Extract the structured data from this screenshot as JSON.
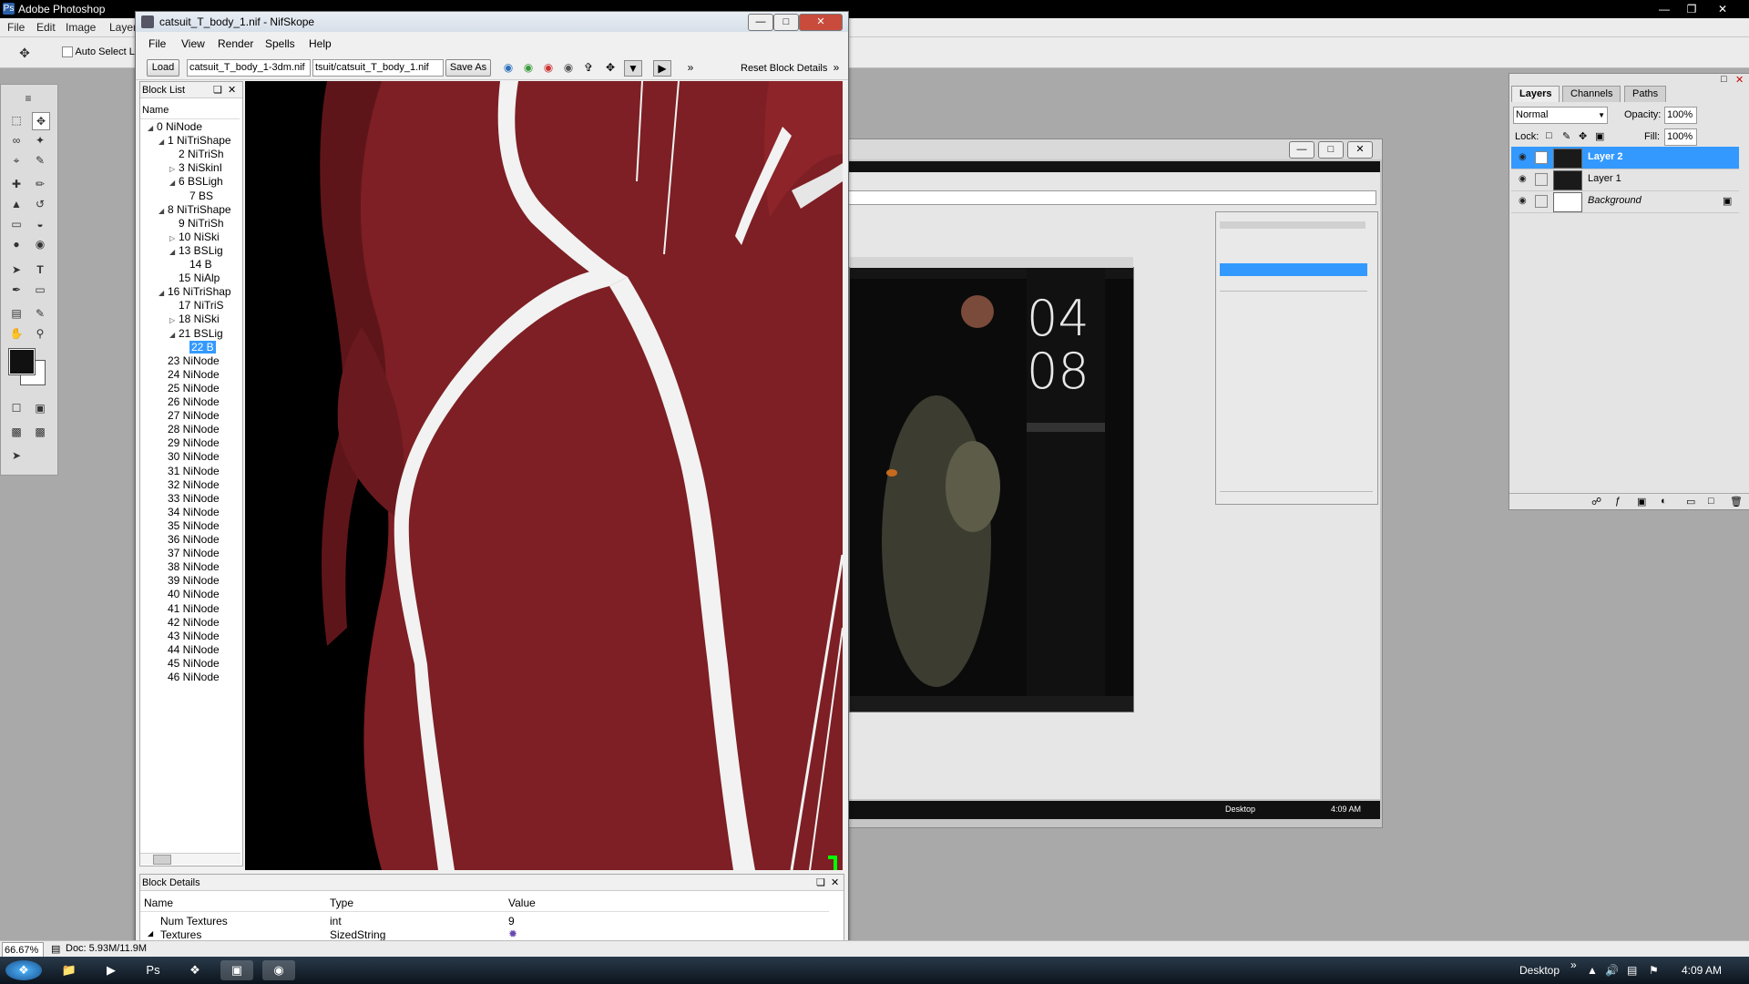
{
  "photoshop": {
    "title": "Adobe Photoshop",
    "menu": [
      "File",
      "Edit",
      "Image",
      "Layer"
    ],
    "auto_select_label": "Auto Select Layer",
    "zoom": "66.67%",
    "doc_info": "Doc: 5.93M/11.9M"
  },
  "nifskope": {
    "title": "catsuit_T_body_1.nif - NifSkope",
    "menu": [
      "File",
      "View",
      "Render",
      "Spells",
      "Help"
    ],
    "load_label": "Load",
    "load_path": "catsuit_T_body_1-3dm.nif",
    "save_path": "tsuit/catsuit_T_body_1.nif",
    "save_as_label": "Save As",
    "reset_label": "Reset Block Details",
    "block_list_title": "Block List",
    "name_header": "Name",
    "blocks": [
      {
        "indent": 0,
        "twisty": "open",
        "label": "0 NiNode"
      },
      {
        "indent": 1,
        "twisty": "open",
        "label": "1 NiTriShape"
      },
      {
        "indent": 2,
        "twisty": "",
        "label": "2 NiTriSh"
      },
      {
        "indent": 2,
        "twisty": "closed",
        "label": "3 NiSkinI"
      },
      {
        "indent": 2,
        "twisty": "open",
        "label": "6 BSLigh"
      },
      {
        "indent": 3,
        "twisty": "",
        "label": "7 BS"
      },
      {
        "indent": 1,
        "twisty": "open",
        "label": "8 NiTriShape"
      },
      {
        "indent": 2,
        "twisty": "",
        "label": "9 NiTriSh"
      },
      {
        "indent": 2,
        "twisty": "closed",
        "label": "10 NiSki"
      },
      {
        "indent": 2,
        "twisty": "open",
        "label": "13 BSLig"
      },
      {
        "indent": 3,
        "twisty": "",
        "label": "14 B"
      },
      {
        "indent": 2,
        "twisty": "",
        "label": "15 NiAlp"
      },
      {
        "indent": 1,
        "twisty": "open",
        "label": "16 NiTriShap"
      },
      {
        "indent": 2,
        "twisty": "",
        "label": "17 NiTriS"
      },
      {
        "indent": 2,
        "twisty": "closed",
        "label": "18 NiSki"
      },
      {
        "indent": 2,
        "twisty": "open",
        "label": "21 BSLig"
      },
      {
        "indent": 3,
        "twisty": "",
        "label": "22 B",
        "selected": true
      },
      {
        "indent": 1,
        "twisty": "",
        "label": "23 NiNode"
      },
      {
        "indent": 1,
        "twisty": "",
        "label": "24 NiNode"
      },
      {
        "indent": 1,
        "twisty": "",
        "label": "25 NiNode"
      },
      {
        "indent": 1,
        "twisty": "",
        "label": "26 NiNode"
      },
      {
        "indent": 1,
        "twisty": "",
        "label": "27 NiNode"
      },
      {
        "indent": 1,
        "twisty": "",
        "label": "28 NiNode"
      },
      {
        "indent": 1,
        "twisty": "",
        "label": "29 NiNode"
      },
      {
        "indent": 1,
        "twisty": "",
        "label": "30 NiNode"
      },
      {
        "indent": 1,
        "twisty": "",
        "label": "31 NiNode"
      },
      {
        "indent": 1,
        "twisty": "",
        "label": "32 NiNode"
      },
      {
        "indent": 1,
        "twisty": "",
        "label": "33 NiNode"
      },
      {
        "indent": 1,
        "twisty": "",
        "label": "34 NiNode"
      },
      {
        "indent": 1,
        "twisty": "",
        "label": "35 NiNode"
      },
      {
        "indent": 1,
        "twisty": "",
        "label": "36 NiNode"
      },
      {
        "indent": 1,
        "twisty": "",
        "label": "37 NiNode"
      },
      {
        "indent": 1,
        "twisty": "",
        "label": "38 NiNode"
      },
      {
        "indent": 1,
        "twisty": "",
        "label": "39 NiNode"
      },
      {
        "indent": 1,
        "twisty": "",
        "label": "40 NiNode"
      },
      {
        "indent": 1,
        "twisty": "",
        "label": "41 NiNode"
      },
      {
        "indent": 1,
        "twisty": "",
        "label": "42 NiNode"
      },
      {
        "indent": 1,
        "twisty": "",
        "label": "43 NiNode"
      },
      {
        "indent": 1,
        "twisty": "",
        "label": "44 NiNode"
      },
      {
        "indent": 1,
        "twisty": "",
        "label": "45 NiNode"
      },
      {
        "indent": 1,
        "twisty": "",
        "label": "46 NiNode"
      }
    ],
    "details_title": "Block Details",
    "details_headers": [
      "Name",
      "Type",
      "Value"
    ],
    "details_rows": [
      {
        "name": "Num Textures",
        "type": "int",
        "value": "9"
      },
      {
        "name": "Textures",
        "type": "SizedString",
        "value": ""
      }
    ]
  },
  "desktop_preview": {
    "clock_top": "04",
    "clock_bottom": "08",
    "taskbar_desktop": "Desktop",
    "taskbar_time": "4:09 AM"
  },
  "layers_panel": {
    "tabs": [
      "Layers",
      "Channels",
      "Paths"
    ],
    "blend_mode": "Normal",
    "opacity_label": "Opacity:",
    "opacity_value": "100%",
    "lock_label": "Lock:",
    "fill_label": "Fill:",
    "fill_value": "100%",
    "layers": [
      {
        "name": "Layer 2",
        "active": true
      },
      {
        "name": "Layer 1",
        "active": false
      },
      {
        "name": "Background",
        "active": false
      }
    ]
  },
  "taskbar": {
    "desktop_label": "Desktop",
    "time": "4:09 AM"
  },
  "colors": {
    "selection": "#3399ff",
    "body_red": "#7d1f24",
    "stripe": "#f2f2f2"
  }
}
